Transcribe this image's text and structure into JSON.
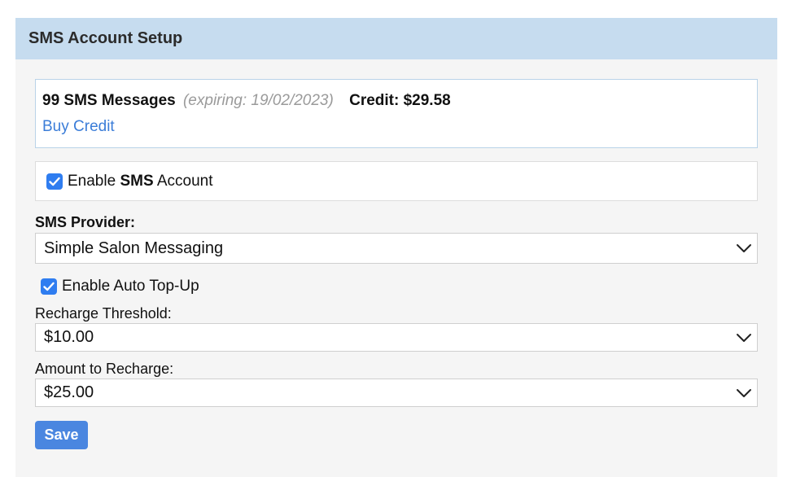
{
  "panel": {
    "title": "SMS Account Setup"
  },
  "credit": {
    "message_count": "99 SMS Messages",
    "expiry": "(expiring: 19/02/2023)",
    "credit_label": "Credit: $29.58",
    "buy_link": "Buy Credit"
  },
  "sms_account": {
    "enable_prefix": "Enable ",
    "enable_bold": "SMS",
    "enable_suffix": " Account",
    "checked": true
  },
  "provider": {
    "label": "SMS Provider:",
    "selected": "Simple Salon Messaging"
  },
  "auto_topup": {
    "label": "Enable Auto Top-Up",
    "checked": true
  },
  "threshold": {
    "label": "Recharge Threshold:",
    "selected": "$10.00"
  },
  "recharge_amount": {
    "label": "Amount to Recharge:",
    "selected": "$25.00"
  },
  "actions": {
    "save_label": "Save"
  },
  "colors": {
    "header_bg": "#c6dcef",
    "panel_bg": "#f5f5f5",
    "accent": "#2f7df0",
    "link": "#3b7dd8",
    "button": "#4a86e0"
  },
  "icons": {
    "checkbox": "check-icon",
    "select_arrow": "chevron-down-icon"
  }
}
